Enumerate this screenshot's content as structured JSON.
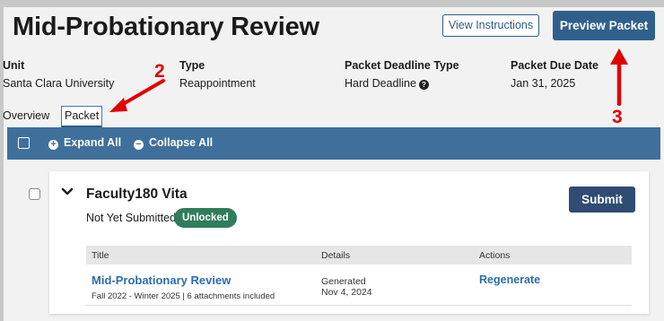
{
  "header": {
    "title": "Mid-Probationary Review",
    "view_instructions_label": "View Instructions",
    "preview_packet_label": "Preview Packet"
  },
  "meta": [
    {
      "label": "Unit",
      "value": "Santa Clara University"
    },
    {
      "label": "Type",
      "value": "Reappointment"
    },
    {
      "label": "Packet Deadline Type",
      "value": "Hard Deadline"
    },
    {
      "label": "Packet Due Date",
      "value": "Jan 31, 2025"
    }
  ],
  "tabs": [
    {
      "label": "Overview",
      "active": false
    },
    {
      "label": "Packet",
      "active": true
    }
  ],
  "toolbar": {
    "expand_label": "Expand All",
    "collapse_label": "Collapse All"
  },
  "section": {
    "title": "Faculty180 Vita",
    "status": "Not Yet Submitted",
    "badge": "Unlocked",
    "submit_label": "Submit",
    "columns": [
      "Title",
      "Details",
      "Actions"
    ],
    "rows": [
      {
        "title": "Mid-Probationary Review",
        "subtitle": "Fall 2022 - Winter 2025 | 6 attachments included",
        "details_line1": "Generated",
        "details_line2": "Nov 4, 2024",
        "action": "Regenerate"
      }
    ]
  },
  "annotations": [
    "2",
    "3"
  ],
  "colors": {
    "primary": "#2f608c",
    "toolbar": "#3f709c",
    "badge_green": "#2e7d5b",
    "link": "#2a6db0",
    "annotation_red": "#e00000"
  }
}
